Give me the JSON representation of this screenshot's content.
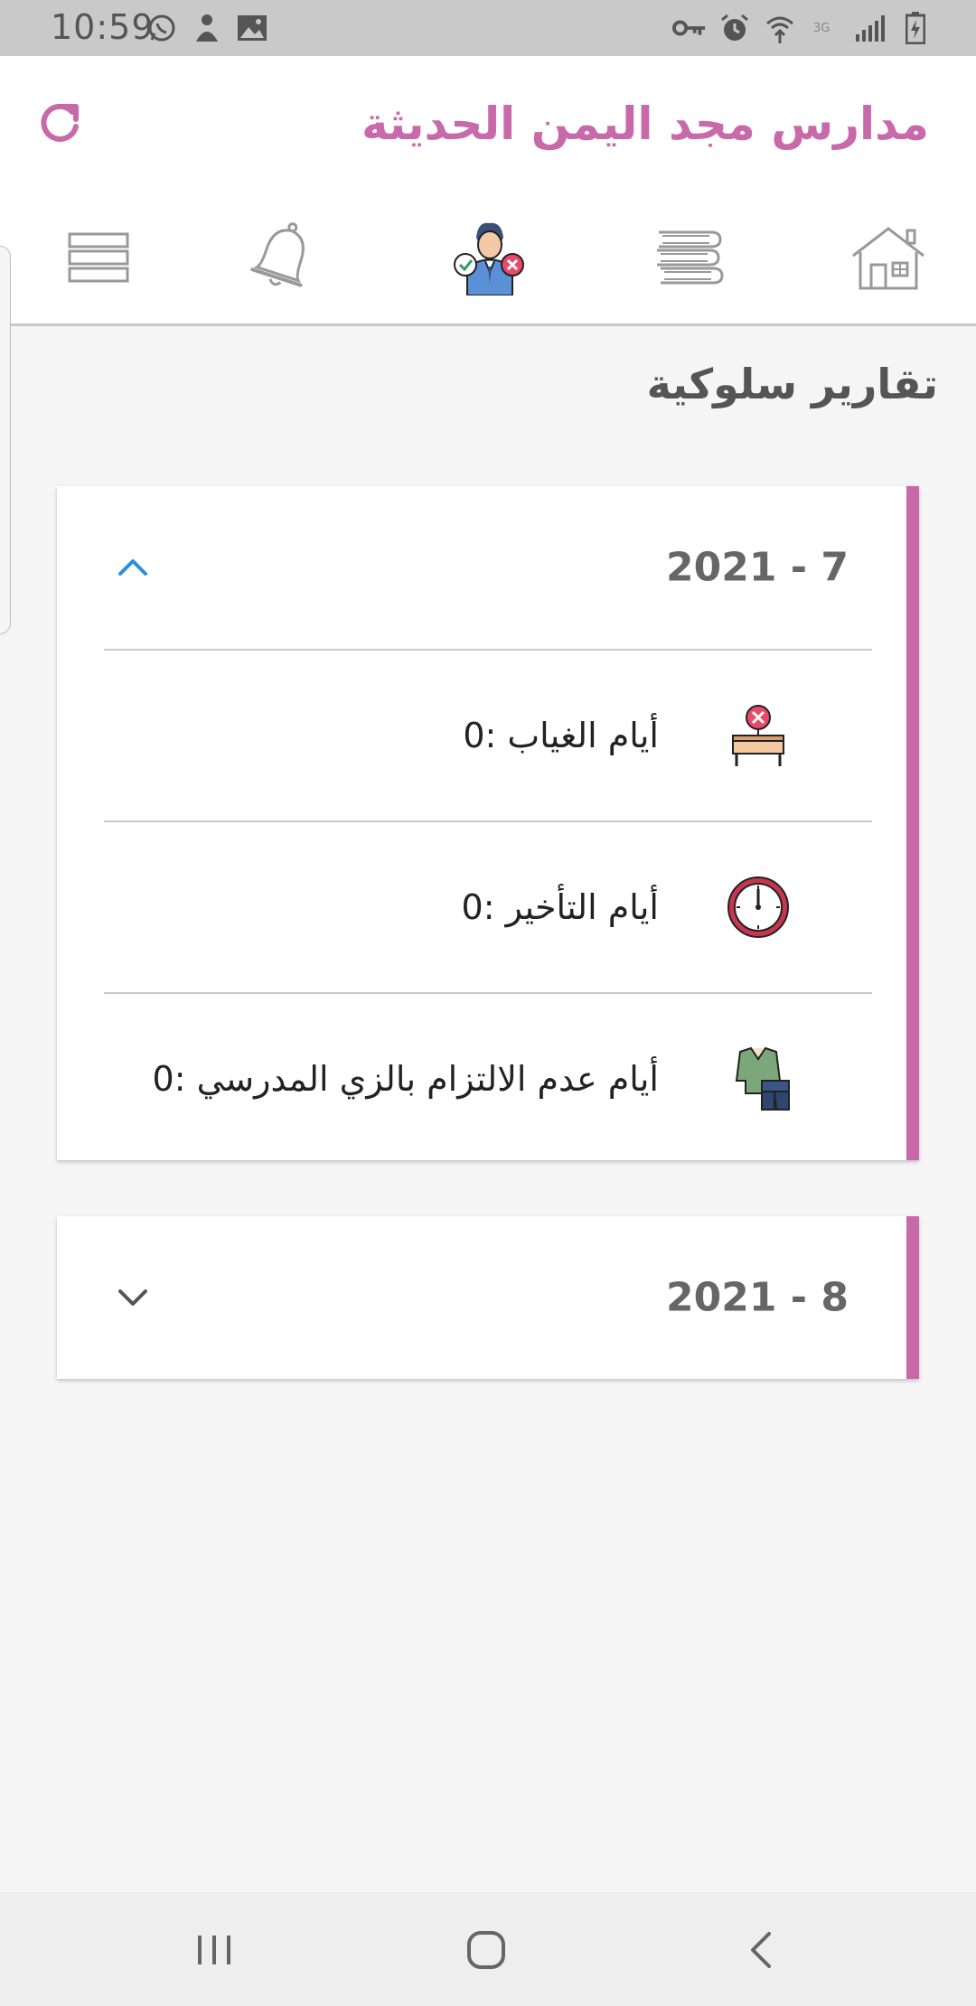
{
  "status_bar": {
    "time": "10:59",
    "left_icons": [
      "whatsapp-icon",
      "person-icon",
      "image-icon"
    ],
    "right_icons": [
      "key-icon",
      "alarm-icon",
      "wifi-icon",
      "network-icon",
      "signal-icon",
      "battery-icon"
    ]
  },
  "app": {
    "title": "مدارس مجد اليمن الحديثة",
    "accent_color": "#c86aaa"
  },
  "nav_tabs": [
    {
      "name": "home",
      "icon": "house-icon"
    },
    {
      "name": "books",
      "icon": "books-icon"
    },
    {
      "name": "behavior",
      "icon": "student-behavior-icon",
      "active": true
    },
    {
      "name": "notifications",
      "icon": "bell-icon"
    },
    {
      "name": "menu",
      "icon": "menu-icon"
    }
  ],
  "page": {
    "title": "تقارير سلوكية"
  },
  "months": [
    {
      "label": "2021 - 7",
      "expanded": true,
      "items": [
        {
          "icon": "absence-desk-icon",
          "text": "أيام الغياب :0"
        },
        {
          "icon": "clock-icon",
          "text": "أيام التأخير :0"
        },
        {
          "icon": "uniform-icon",
          "text": "أيام عدم الالتزام بالزي المدرسي :0"
        }
      ]
    },
    {
      "label": "2021 - 8",
      "expanded": false,
      "items": []
    }
  ],
  "system_nav": [
    "recents-icon",
    "home-icon",
    "back-icon"
  ]
}
